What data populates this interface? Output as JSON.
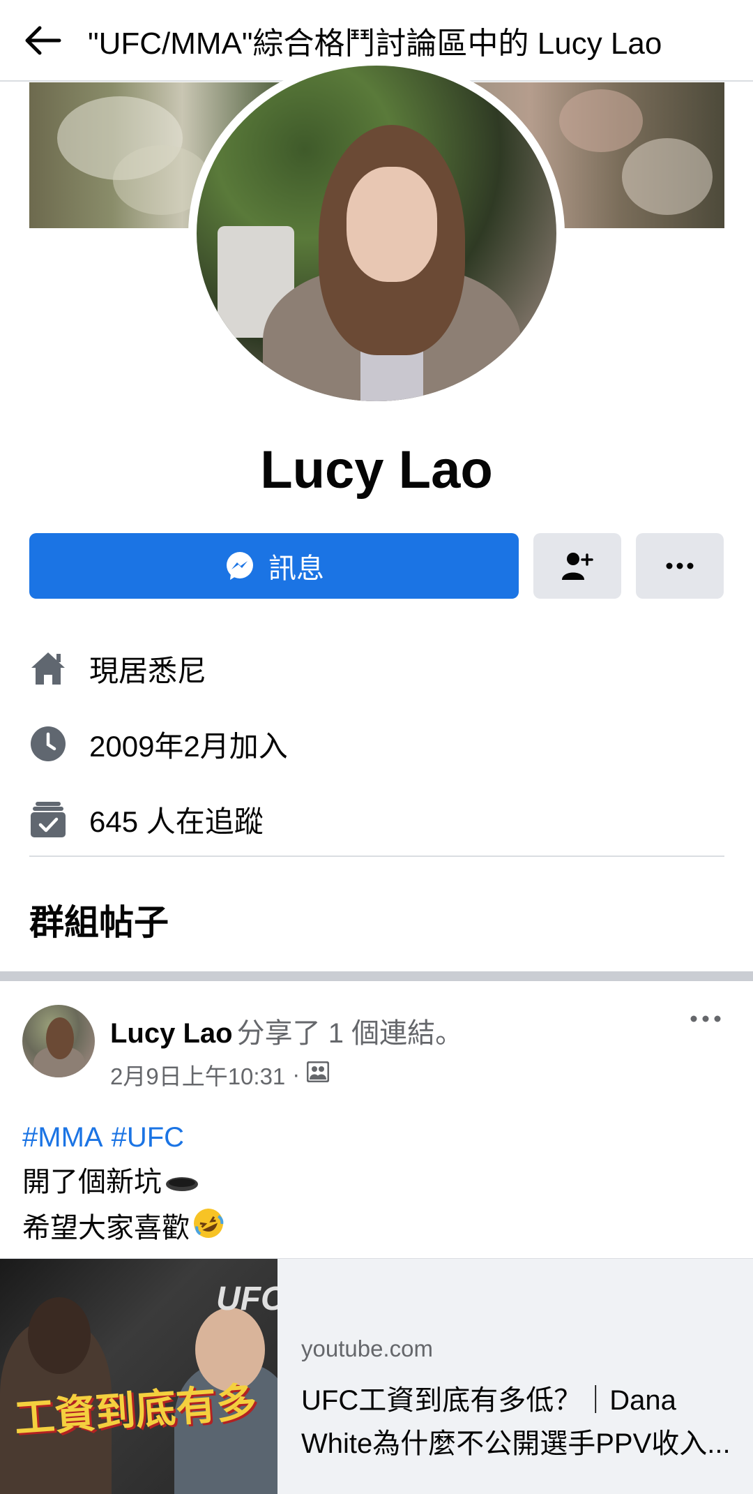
{
  "header": {
    "title": "\"UFC/MMA\"綜合格鬥討論區中的 Lucy Lao"
  },
  "profile": {
    "name": "Lucy Lao",
    "message_button": "訊息"
  },
  "info": [
    {
      "icon": "home-icon",
      "text": "現居悉尼"
    },
    {
      "icon": "clock-icon",
      "text": "2009年2月加入"
    },
    {
      "icon": "followers-icon",
      "text": "645 人在追蹤"
    }
  ],
  "section_title": "群組帖子",
  "post": {
    "author": "Lucy Lao",
    "action": "分享了 1 個連結。",
    "timestamp": "2月9日上午10:31",
    "meta_separator": "·",
    "hashtags": [
      "#MMA",
      "#UFC"
    ],
    "line1": "開了個新坑",
    "line2": "希望大家喜歡",
    "link": {
      "source": "youtube.com",
      "title_line1": "UFC工資到底有多低？｜Dana",
      "title_line2": "White為什麼不公開選手PPV收入...",
      "thumb_text": "工資到底有多",
      "thumb_logo": "UFC"
    }
  },
  "colors": {
    "accent": "#1b74e4",
    "secondary_text": "#65676b",
    "button_gray": "#e4e6eb"
  }
}
